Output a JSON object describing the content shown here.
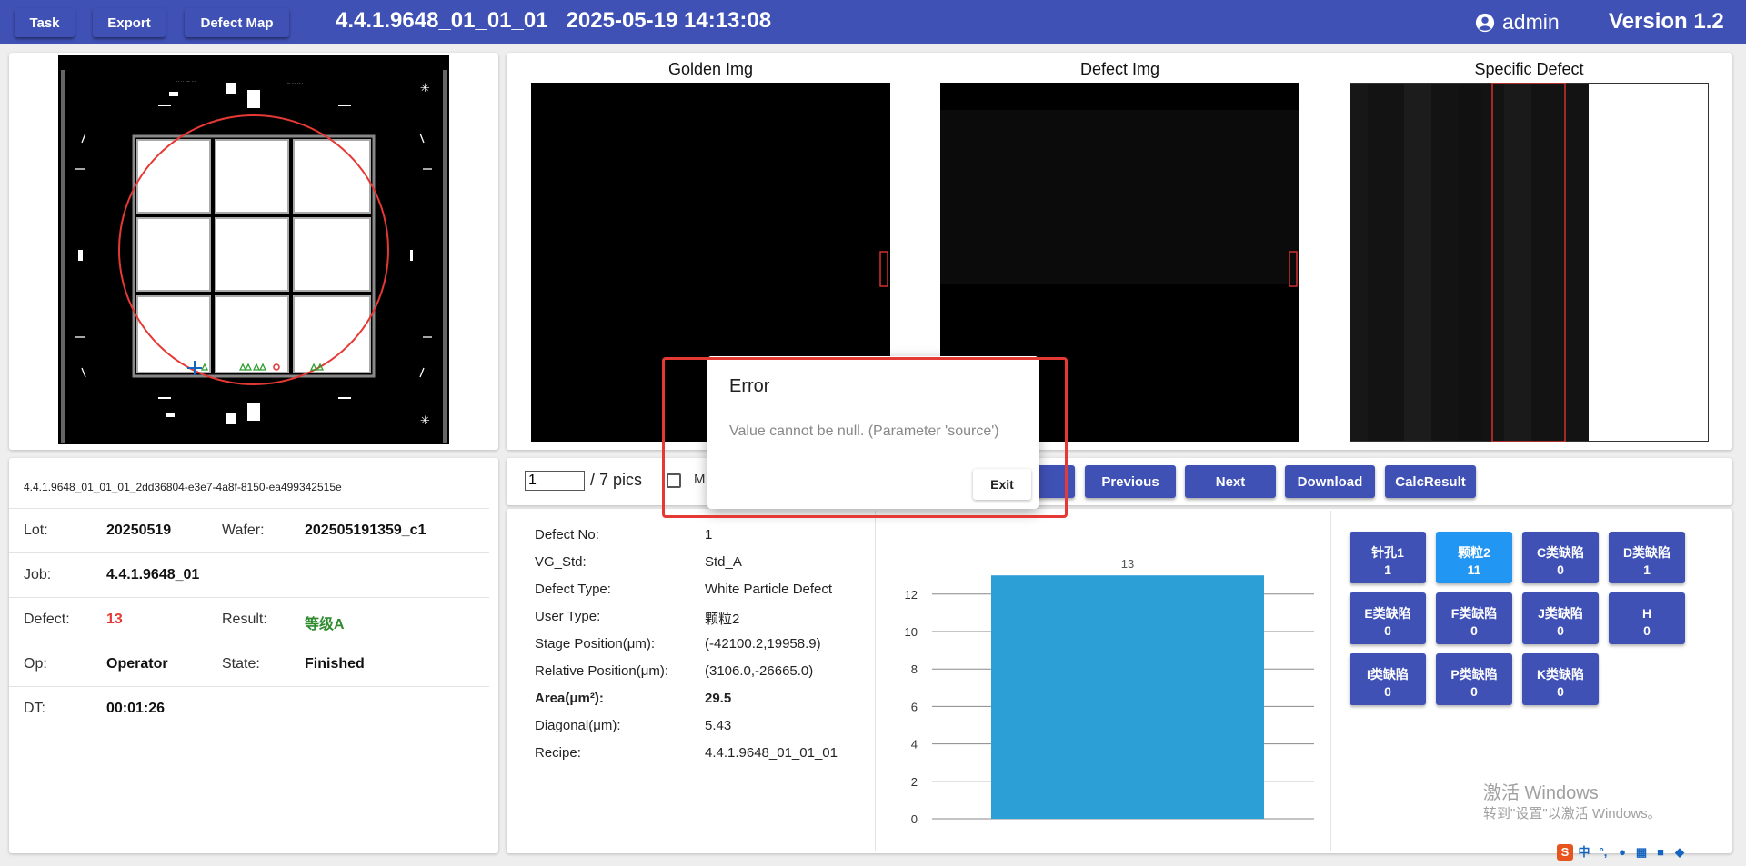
{
  "header": {
    "task_label": "Task",
    "export_label": "Export",
    "defect_map_label": "Defect Map",
    "title": "4.4.1.9648_01_01_01   2025-05-19 14:13:08",
    "user": "admin",
    "version": "Version 1.2"
  },
  "images": {
    "golden_label": "Golden Img",
    "defect_label": "Defect Img",
    "specific_label": "Specific Defect"
  },
  "info": {
    "file_name": "4.4.1.9648_01_01_01_2dd36804-e3e7-4a8f-8150-ea499342515e",
    "lot_label": "Lot:",
    "lot": "20250519",
    "wafer_label": "Wafer:",
    "wafer": "202505191359_c1",
    "job_label": "Job:",
    "job": "4.4.1.9648_01",
    "defect_label": "Defect:",
    "defect": "13",
    "result_label": "Result:",
    "result": "等级A",
    "op_label": "Op:",
    "op": "Operator",
    "state_label": "State:",
    "state": "Finished",
    "dt_label": "DT:",
    "dt": "00:01:26"
  },
  "pager": {
    "current": "1",
    "total": "/ 7 pics",
    "checkbox_label": "M"
  },
  "actions": {
    "previous": "Previous",
    "next": "Next",
    "download": "Download",
    "calc": "CalcResult"
  },
  "detail": {
    "defect_no_label": "Defect No:",
    "defect_no": "1",
    "vg_std_label": "VG_Std:",
    "vg_std": "Std_A",
    "defect_type_label": "Defect Type:",
    "defect_type": "White Particle Defect",
    "user_type_label": "User Type:",
    "user_type": "颗粒2",
    "stage_label": "Stage Position(μm):",
    "stage": "(-42100.2,19958.9)",
    "relative_label": "Relative Position(μm):",
    "relative": "(3106.0,-26665.0)",
    "area_label": "Area(μm²):",
    "area": "29.5",
    "diagonal_label": "Diagonal(μm):",
    "diagonal": "5.43",
    "recipe_label": "Recipe:",
    "recipe": "4.4.1.9648_01_01_01"
  },
  "chart_data": {
    "type": "bar",
    "categories": [
      ""
    ],
    "values": [
      13
    ],
    "data_labels": [
      "13"
    ],
    "ylim": [
      0,
      13
    ],
    "yticks": [
      "12",
      "10",
      "8",
      "6",
      "4",
      "2",
      "0"
    ],
    "bar_color": "#2b9fd6",
    "grid": true
  },
  "categories": [
    {
      "name": "针孔1",
      "count": "1",
      "active": false
    },
    {
      "name": "颗粒2",
      "count": "11",
      "active": true
    },
    {
      "name": "C类缺陷",
      "count": "0",
      "active": false
    },
    {
      "name": "D类缺陷",
      "count": "1",
      "active": false
    },
    {
      "name": "E类缺陷",
      "count": "0",
      "active": false
    },
    {
      "name": "F类缺陷",
      "count": "0",
      "active": false
    },
    {
      "name": "J类缺陷",
      "count": "0",
      "active": false
    },
    {
      "name": "H",
      "count": "0",
      "active": false
    },
    {
      "name": "I类缺陷",
      "count": "0",
      "active": false
    },
    {
      "name": "P类缺陷",
      "count": "0",
      "active": false
    },
    {
      "name": "K类缺陷",
      "count": "0",
      "active": false
    }
  ],
  "dialog": {
    "title": "Error",
    "message": "Value cannot be null. (Parameter 'source')",
    "exit_label": "Exit"
  },
  "watermark": {
    "line1": "激活 Windows",
    "line2": "转到\"设置\"以激活 Windows。"
  },
  "tray": {
    "ime": "中"
  },
  "colors": {
    "primary": "#3f51b5",
    "accent_blue": "#2196f3",
    "defect_count": "#e53935",
    "result_ok": "#2e8b2e",
    "error_highlight": "#e53935"
  }
}
